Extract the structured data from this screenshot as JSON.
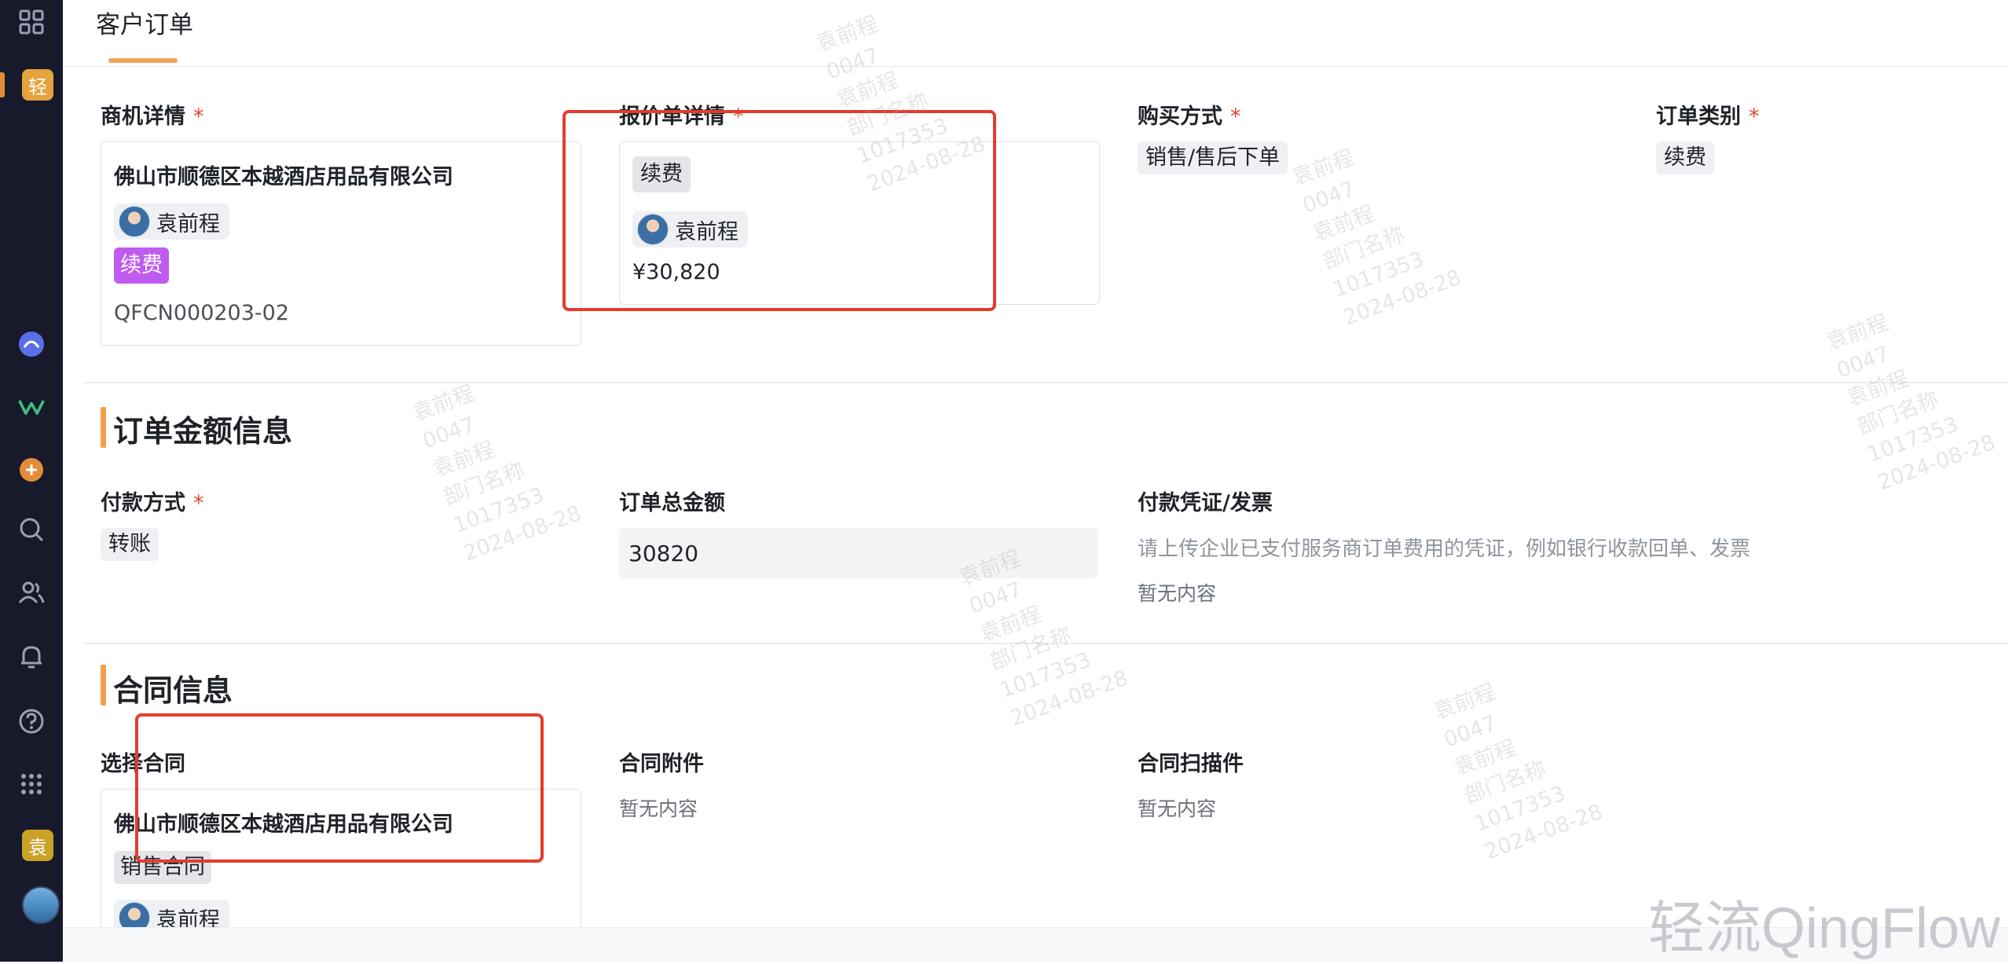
{
  "tab": {
    "title": "客户订单"
  },
  "fields": {
    "opportunity": {
      "label": "商机详情",
      "required": "*",
      "title": "佛山市顺德区本越酒店用品有限公司",
      "owner": "袁前程",
      "tag": "续费",
      "code": "QFCN000203-02"
    },
    "quote": {
      "label": "报价单详情",
      "required": "*",
      "tag": "续费",
      "owner": "袁前程",
      "amount": "¥30,820"
    },
    "purchase_method": {
      "label": "购买方式",
      "required": "*",
      "value": "销售/售后下单"
    },
    "order_type": {
      "label": "订单类别",
      "required": "*",
      "value": "续费"
    }
  },
  "amount_section": {
    "title": "订单金额信息",
    "payment_method": {
      "label": "付款方式",
      "required": "*",
      "value": "转账"
    },
    "total_amount": {
      "label": "订单总金额",
      "value": "30820"
    },
    "voucher": {
      "label": "付款凭证/发票",
      "hint": "请上传企业已支付服务商订单费用的凭证，例如银行收款回单、发票",
      "empty": "暂无内容"
    }
  },
  "contract_section": {
    "title": "合同信息",
    "select_contract": {
      "label": "选择合同",
      "title": "佛山市顺德区本越酒店用品有限公司",
      "tag": "销售合同",
      "owner": "袁前程"
    },
    "attachments": {
      "label": "合同附件",
      "empty": "暂无内容"
    },
    "scans": {
      "label": "合同扫描件",
      "empty": "暂无内容"
    }
  },
  "watermark": {
    "lines": "袁前程\n0047\n袁前程\n部门名称\n1017353\n2024-08-28"
  },
  "brand": {
    "text": "轻流QingFlow"
  },
  "sidebar": {
    "app_badge": "轻",
    "user_badge": "袁",
    "icons": [
      "grid-icon",
      "app-badge",
      "round-app-icon",
      "wechat-work-icon",
      "add-icon",
      "search-icon",
      "users-icon",
      "bell-icon",
      "help-icon",
      "apps-icon",
      "user-badge",
      "avatar"
    ]
  },
  "colors": {
    "accent": "#f0a04b",
    "required": "#e5452f",
    "tag_purple": "#c05bf0",
    "highlight": "#e53b2c"
  }
}
